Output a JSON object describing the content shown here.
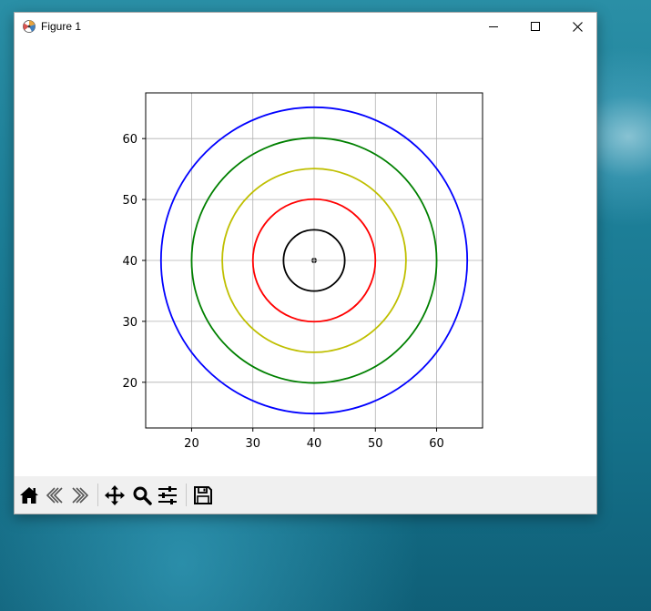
{
  "window": {
    "title": "Figure 1",
    "controls": [
      "minimize-icon",
      "maximize-icon",
      "close-icon"
    ]
  },
  "toolbar": {
    "buttons": [
      {
        "name": "home-button",
        "icon": "home-icon"
      },
      {
        "name": "back-button",
        "icon": "back-arrow-icon"
      },
      {
        "name": "forward-button",
        "icon": "forward-arrow-icon"
      },
      {
        "name": "pan-button",
        "icon": "pan-icon"
      },
      {
        "name": "zoom-button",
        "icon": "zoom-icon"
      },
      {
        "name": "configure-subplots-button",
        "icon": "sliders-icon"
      },
      {
        "name": "save-button",
        "icon": "save-icon"
      }
    ]
  },
  "chart_data": {
    "type": "scatter",
    "title": "",
    "xlabel": "",
    "ylabel": "",
    "xlim": [
      12.5,
      67.5
    ],
    "ylim": [
      12.5,
      67.5
    ],
    "grid": true,
    "xticks": [
      20,
      30,
      40,
      50,
      60
    ],
    "yticks": [
      20,
      30,
      40,
      50,
      60
    ],
    "center": {
      "x": 40,
      "y": 40
    },
    "circles": [
      {
        "radius": 25,
        "color": "#0000ff"
      },
      {
        "radius": 20,
        "color": "#008000"
      },
      {
        "radius": 15,
        "color": "#bfbf00"
      },
      {
        "radius": 10,
        "color": "#ff0000"
      },
      {
        "radius": 5,
        "color": "#000000"
      }
    ]
  }
}
